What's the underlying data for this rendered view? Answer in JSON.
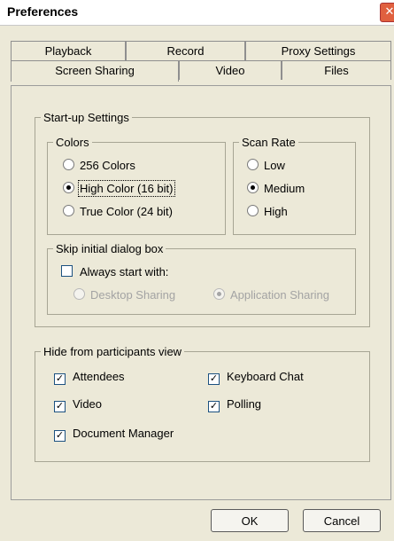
{
  "window": {
    "title": "Preferences"
  },
  "tabs": {
    "row1": [
      "Playback",
      "Record",
      "Proxy Settings"
    ],
    "row2": [
      "Screen Sharing",
      "Video",
      "Files"
    ],
    "active": "Screen Sharing"
  },
  "startup": {
    "legend": "Start-up Settings",
    "colors": {
      "legend": "Colors",
      "options": [
        "256 Colors",
        "High Color (16 bit)",
        "True Color (24 bit)"
      ],
      "selected": "High Color (16 bit)"
    },
    "scan_rate": {
      "legend": "Scan Rate",
      "options": [
        "Low",
        "Medium",
        "High"
      ],
      "selected": "Medium"
    },
    "skip_dialog": {
      "legend": "Skip initial dialog box",
      "always_start_label": "Always start with:",
      "always_start_checked": false,
      "options": [
        "Desktop Sharing",
        "Application Sharing"
      ],
      "selected": "Application Sharing"
    }
  },
  "hide": {
    "legend": "Hide from participants view",
    "items": [
      {
        "label": "Attendees",
        "checked": true
      },
      {
        "label": "Keyboard Chat",
        "checked": true
      },
      {
        "label": "Video",
        "checked": true
      },
      {
        "label": "Polling",
        "checked": true
      },
      {
        "label": "Document Manager",
        "checked": true
      }
    ]
  },
  "buttons": {
    "ok": "OK",
    "cancel": "Cancel"
  },
  "glyphs": {
    "close": "✕",
    "check": "✓"
  }
}
